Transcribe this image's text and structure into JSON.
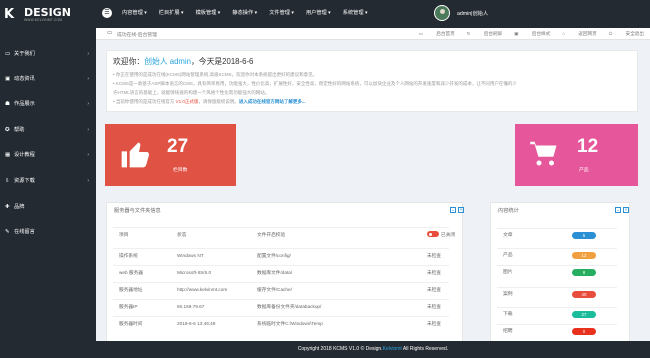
{
  "app": {
    "logo_mark": "K",
    "logo_word": "DESIGN",
    "logo_sub": "WWW.KELVINMT.COM"
  },
  "topnav": [
    "内容管理 ▾",
    "栏目扩展 ▾",
    "模板管理 ▾",
    "静态操作 ▾",
    "文件管理 ▾",
    "用户管理 ▾",
    "系统管理 ▾"
  ],
  "user": {
    "name": "admin|创始人"
  },
  "sidebar": [
    {
      "icon": "▭",
      "label": "关于我们"
    },
    {
      "icon": "▣",
      "label": "动态资讯"
    },
    {
      "icon": "☗",
      "label": "作品展示"
    },
    {
      "icon": "✪",
      "label": "帮助"
    },
    {
      "icon": "▦",
      "label": "设计教程"
    },
    {
      "icon": "⇩",
      "label": "资源下载"
    },
    {
      "icon": "✚",
      "label": "品牌"
    },
    {
      "icon": "✎",
      "label": "在线留言"
    }
  ],
  "breadcrumb": {
    "path": "成功在线-后台管理"
  },
  "toolbar": {
    "home": "后台首页",
    "refresh": "后台刷屏",
    "style": "后台样式",
    "website": "返回网页",
    "logout": "安全退出"
  },
  "welcome": {
    "greet_prefix": "欢迎你：",
    "greet_user": "创始人 admin",
    "greet_suffix": "，今天是2018-6-6",
    "line1": "• 你正在使用的是成功在线(KCMS)网站管理系统,高级KCMS，欢迎你对本系统提出更好的建议和意见。",
    "line2": "• KCMS是一款基于ASP脚本语言的CMS，具有简单易用，功能强大，性价比高，扩展性好，安全性高，稳定性好的网站系统，可以加快企业及个人网站的开发速度和减少开发的成本，让不同用户在懂的少",
    "line3": "许HTML语言的基础上，就能够快速的构建一个风格个性化而功能强大的网站。",
    "line4_prefix": "• 当前你使用的是成功在线官方 ",
    "line4_version": "V1.0正式版",
    "line4_mid": "，请保留版权说明。",
    "line4_link": "进入成功在线官方网站了解更多..."
  },
  "stats": [
    {
      "value": "27",
      "label": "栏目数",
      "color": "#e05244"
    },
    {
      "value": "12",
      "label": "产品",
      "color": "#e5569a"
    }
  ],
  "server_panel": {
    "title": "服务器与文件夹信息",
    "rows": [
      {
        "k1": "项目",
        "v1": "状态",
        "k2": "文件开启校验",
        "v2": "已关闭",
        "toggle": true
      },
      {
        "k1": "操作系统",
        "v1": "Windows NT",
        "k2": "配置文件/config/",
        "v2": "未检查"
      },
      {
        "k1": "web 服务器",
        "v1": "Microsoft-IIS/6.0",
        "k2": "数据库文件/data/",
        "v2": "未检查"
      },
      {
        "k1": "服务器地址",
        "v1": "http://www.kelvinmt.com",
        "k2": "缓存文件/Cache/",
        "v2": "未检查"
      },
      {
        "k1": "服务器IP",
        "v1": "60.169.79.67",
        "k2": "数据库备份文件夹/databackup/",
        "v2": "未检查"
      },
      {
        "k1": "服务器时间",
        "v1": "2018-6-6 13:46:49",
        "k2": "系统临时文件C:\\Windows\\Temp",
        "v2": "未检查"
      }
    ]
  },
  "content_panel": {
    "title": "内容统计",
    "rows": [
      {
        "label": "文章",
        "value": "5",
        "color": "#2a8fd4"
      },
      {
        "label": "产品",
        "value": "12",
        "color": "#f0a040"
      },
      {
        "label": "图片",
        "value": "8",
        "color": "#27ae60"
      },
      {
        "label": "案例",
        "value": "40",
        "color": "#e74c3c"
      },
      {
        "label": "下载",
        "value": "27",
        "color": "#1abc9c"
      },
      {
        "label": "招聘",
        "value": "0",
        "color": "#e8301c"
      }
    ]
  },
  "footer": {
    "prefix": "Copyright 2018 KCMS V1.0 © Design.",
    "link": "Kelvinmt",
    "suffix": " All Rights Reserved."
  }
}
